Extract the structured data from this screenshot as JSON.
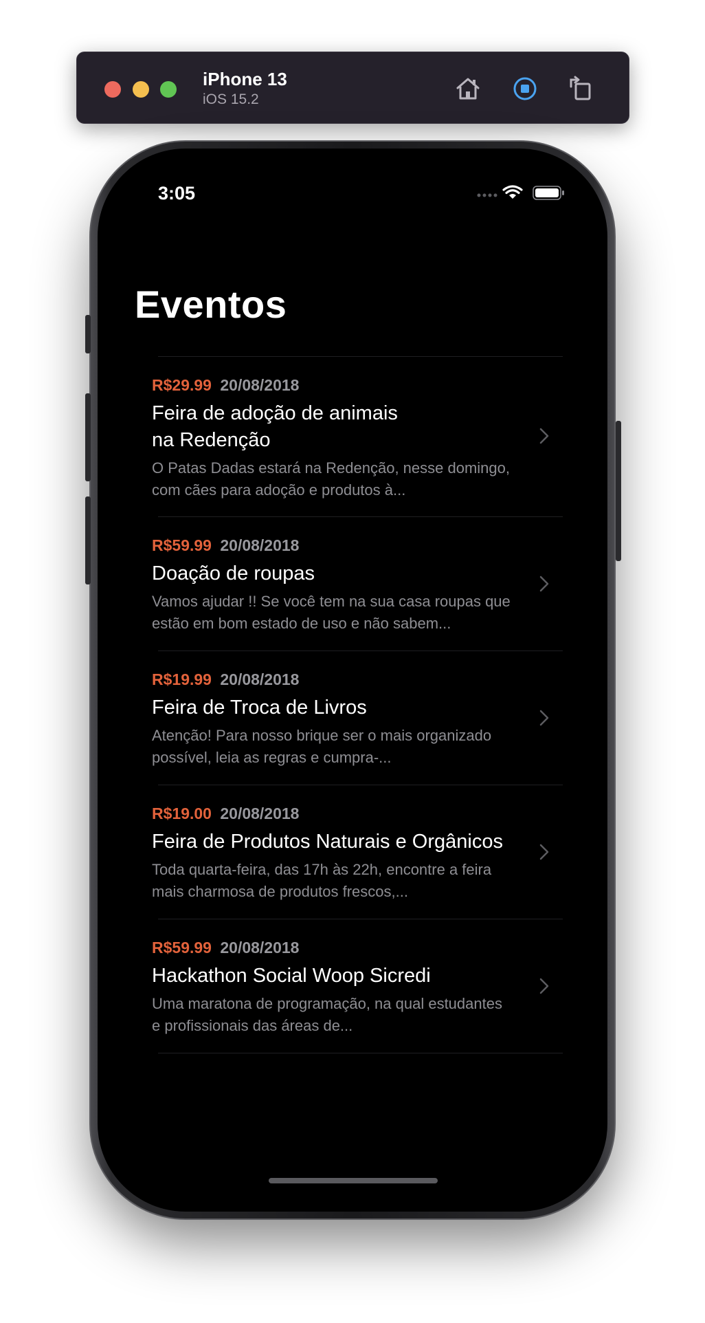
{
  "simulator": {
    "device_name": "iPhone 13",
    "os_version": "iOS 15.2",
    "icons": [
      "home-icon",
      "screenshot-icon",
      "rotate-icon"
    ]
  },
  "status_bar": {
    "time": "3:05",
    "icons": [
      "signal-dots-icon",
      "wifi-icon",
      "battery-icon"
    ]
  },
  "page": {
    "title": "Eventos"
  },
  "colors": {
    "price": "#e2623b",
    "background": "#000000",
    "date": "#98989d"
  },
  "events": [
    {
      "price": "R$29.99",
      "date": "20/08/2018",
      "title": "Feira de adoção de animais\nna Redenção",
      "description": "O Patas Dadas estará na Redenção, nesse domingo, com cães para adoção e produtos à..."
    },
    {
      "price": "R$59.99",
      "date": "20/08/2018",
      "title": "Doação de roupas",
      "description": "Vamos ajudar !!  Se você tem na sua casa roupas que estão em bom estado de uso e não sabem..."
    },
    {
      "price": "R$19.99",
      "date": "20/08/2018",
      "title": "Feira de Troca de Livros",
      "description": "Atenção! Para nosso brique ser o mais organizado possível, leia as regras e cumpra-..."
    },
    {
      "price": "R$19.00",
      "date": "20/08/2018",
      "title": "Feira de Produtos Naturais e Orgânicos",
      "description": "Toda quarta-feira, das 17h às 22h, encontre a feira mais charmosa de produtos frescos,..."
    },
    {
      "price": "R$59.99",
      "date": "20/08/2018",
      "title": "Hackathon Social Woop Sicredi",
      "description": "Uma maratona de programação, na qual estudantes e profissionais das áreas de..."
    }
  ]
}
